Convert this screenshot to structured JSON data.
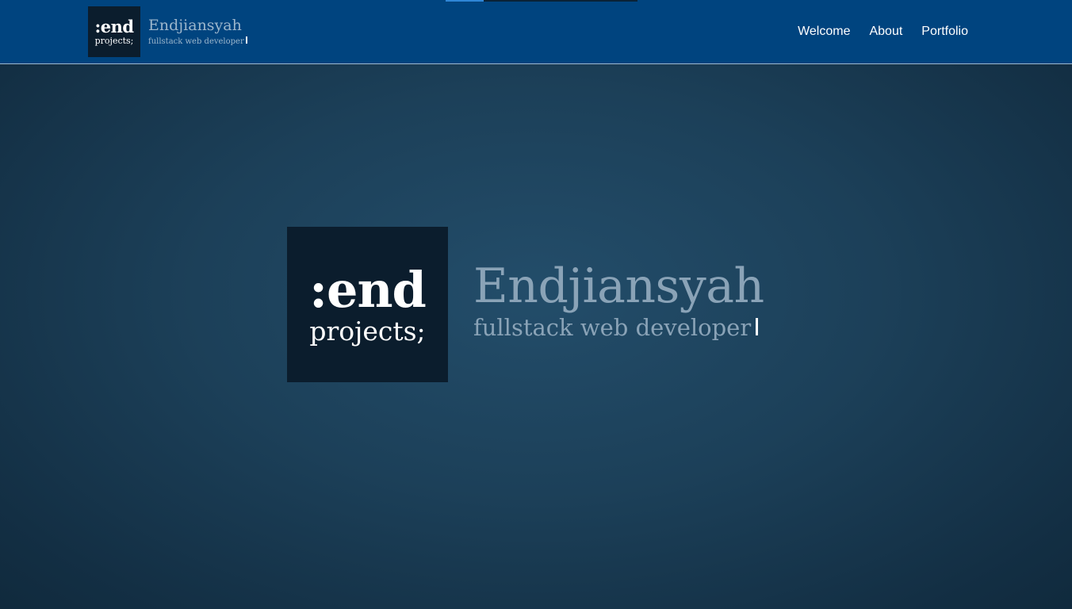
{
  "header": {
    "loading_progress": 0.2,
    "brand": {
      "logo_line1": ":end",
      "logo_line2": "projects;",
      "name": "Endjiansyah",
      "tagline": "fullstack web developer"
    },
    "nav": [
      {
        "label": "Welcome"
      },
      {
        "label": "About"
      },
      {
        "label": "Portfolio"
      }
    ]
  },
  "hero": {
    "logo_line1": ":end",
    "logo_line2": "projects;",
    "name": "Endjiansyah",
    "tagline": "fullstack web developer"
  },
  "colors": {
    "header_bg": "#00447f",
    "logo_bg": "#0b1d2d",
    "muted_text": "#8aa3b7",
    "page_bg": "#1c4059",
    "progress_accent": "#2f86d6"
  }
}
